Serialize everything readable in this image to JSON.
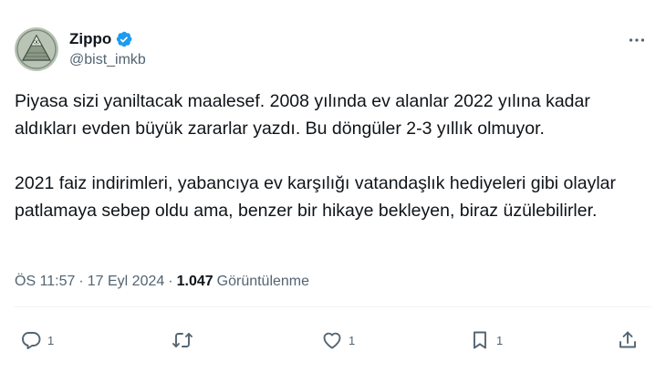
{
  "author": {
    "display_name": "Zippo",
    "handle": "@bist_imkb",
    "verified_icon": "verified-badge-icon",
    "verified_color": "#1d9bf0"
  },
  "tweet": {
    "paragraph_1": "Piyasa sizi yaniltacak maalesef. 2008 yılında ev alanlar 2022 yılına kadar aldıkları evden büyük zararlar yazdı. Bu döngüler 2-3 yıllık olmuyor.",
    "paragraph_2": "2021 faiz indirimleri, yabancıya ev karşılığı vatandaşlık hediyeleri gibi olaylar patlamaya sebep oldu ama, benzer bir hikaye bekleyen, biraz üzülebilirler."
  },
  "meta": {
    "time": "ÖS 11:57",
    "separator": "·",
    "date": "17 Eyl 2024",
    "views_count": "1.047",
    "views_label": "Görüntülenme"
  },
  "actions": {
    "reply_count": "1",
    "retweet_count": "",
    "like_count": "1",
    "bookmark_count": "1"
  },
  "colors": {
    "text_primary": "#0f1419",
    "text_secondary": "#536471",
    "divider": "#eff3f4"
  }
}
